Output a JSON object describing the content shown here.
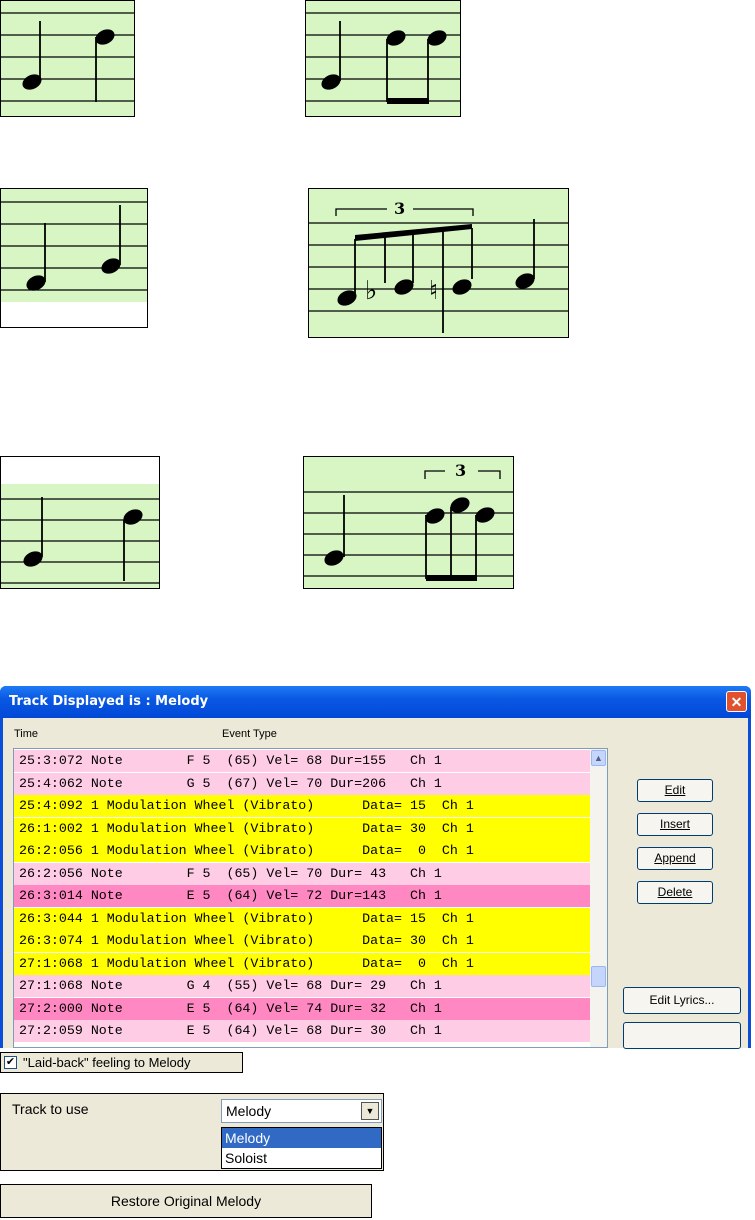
{
  "window": {
    "title": "Track Displayed is : Melody",
    "columns": {
      "time": "Time",
      "event_type": "Event Type"
    },
    "colors": {
      "pink": "#ffcce5",
      "dark_pink": "#ff88c3",
      "yellow": "#ffff00"
    },
    "rows": [
      {
        "text": "25:3:072 Note        F 5  (65) Vel= 68 Dur=155   Ch 1",
        "color": "pink"
      },
      {
        "text": "25:4:062 Note        G 5  (67) Vel= 70 Dur=206   Ch 1",
        "color": "pink"
      },
      {
        "text": "25:4:092 1 Modulation Wheel (Vibrato)      Data= 15  Ch 1",
        "color": "yellow"
      },
      {
        "text": "26:1:002 1 Modulation Wheel (Vibrato)      Data= 30  Ch 1",
        "color": "yellow"
      },
      {
        "text": "26:2:056 1 Modulation Wheel (Vibrato)      Data=  0  Ch 1",
        "color": "yellow"
      },
      {
        "text": "26:2:056 Note        F 5  (65) Vel= 70 Dur= 43   Ch 1",
        "color": "pink"
      },
      {
        "text": "26:3:014 Note        E 5  (64) Vel= 72 Dur=143   Ch 1",
        "color": "dark_pink"
      },
      {
        "text": "26:3:044 1 Modulation Wheel (Vibrato)      Data= 15  Ch 1",
        "color": "yellow"
      },
      {
        "text": "26:3:074 1 Modulation Wheel (Vibrato)      Data= 30  Ch 1",
        "color": "yellow"
      },
      {
        "text": "27:1:068 1 Modulation Wheel (Vibrato)      Data=  0  Ch 1",
        "color": "yellow"
      },
      {
        "text": "27:1:068 Note        G 4  (55) Vel= 68 Dur= 29   Ch 1",
        "color": "pink"
      },
      {
        "text": "27:2:000 Note        E 5  (64) Vel= 74 Dur= 32   Ch 1",
        "color": "dark_pink"
      },
      {
        "text": "27:2:059 Note        E 5  (64) Vel= 68 Dur= 30   Ch 1",
        "color": "pink"
      }
    ],
    "buttons": {
      "edit": "Edit",
      "insert": "Insert",
      "append": "Append",
      "delete": "Delete",
      "edit_lyrics": "Edit Lyrics..."
    }
  },
  "laid_back": {
    "label": "\"Laid-back\" feeling to Melody",
    "checked": true
  },
  "track_to_use": {
    "label": "Track to use",
    "selected": "Melody",
    "options": [
      "Melody",
      "Soloist"
    ]
  },
  "restore_button": "Restore Original Melody"
}
